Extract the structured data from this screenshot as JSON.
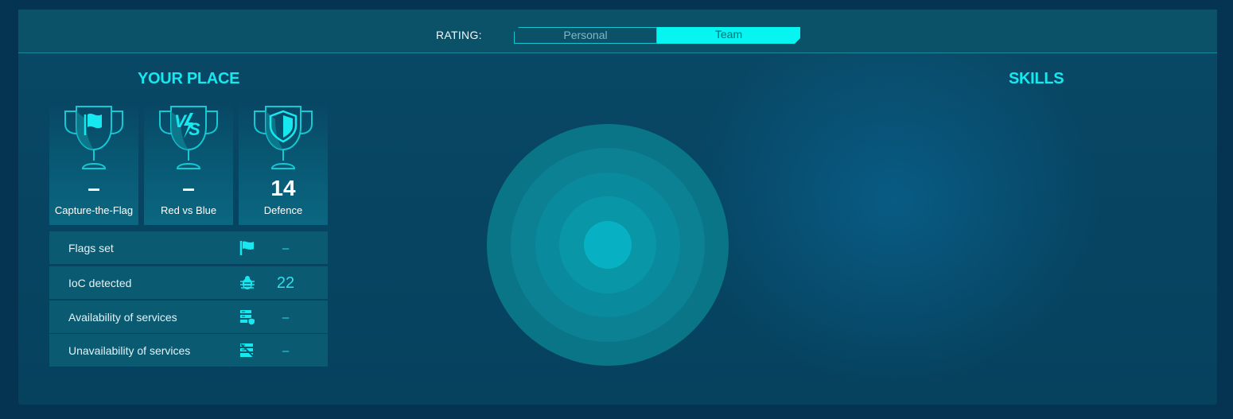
{
  "header": {
    "rating_label": "RATING:",
    "tabs": [
      {
        "label": "Personal",
        "active": false
      },
      {
        "label": "Team",
        "active": true
      }
    ]
  },
  "your_place": {
    "title": "YOUR PLACE",
    "trophies": [
      {
        "icon": "flag-trophy-icon",
        "value": "–",
        "label": "Capture-the-Flag"
      },
      {
        "icon": "vs-trophy-icon",
        "value": "–",
        "label": "Red vs Blue"
      },
      {
        "icon": "shield-trophy-icon",
        "value": "14",
        "label": "Defence"
      }
    ],
    "stats": [
      {
        "label": "Flags set",
        "icon": "flag-icon",
        "value": "–"
      },
      {
        "label": "IoC detected",
        "icon": "bug-icon",
        "value": "22"
      },
      {
        "label": "Availability of services",
        "icon": "server-shield-icon",
        "value": "–"
      },
      {
        "label": "Unavailability of services",
        "icon": "server-off-icon",
        "value": "–"
      }
    ]
  },
  "skills": {
    "title": "SKILLS"
  },
  "colors": {
    "accent": "#17e8ef",
    "toggle_active": "#06f5f0",
    "panel": "#074563",
    "background": "#053452"
  }
}
